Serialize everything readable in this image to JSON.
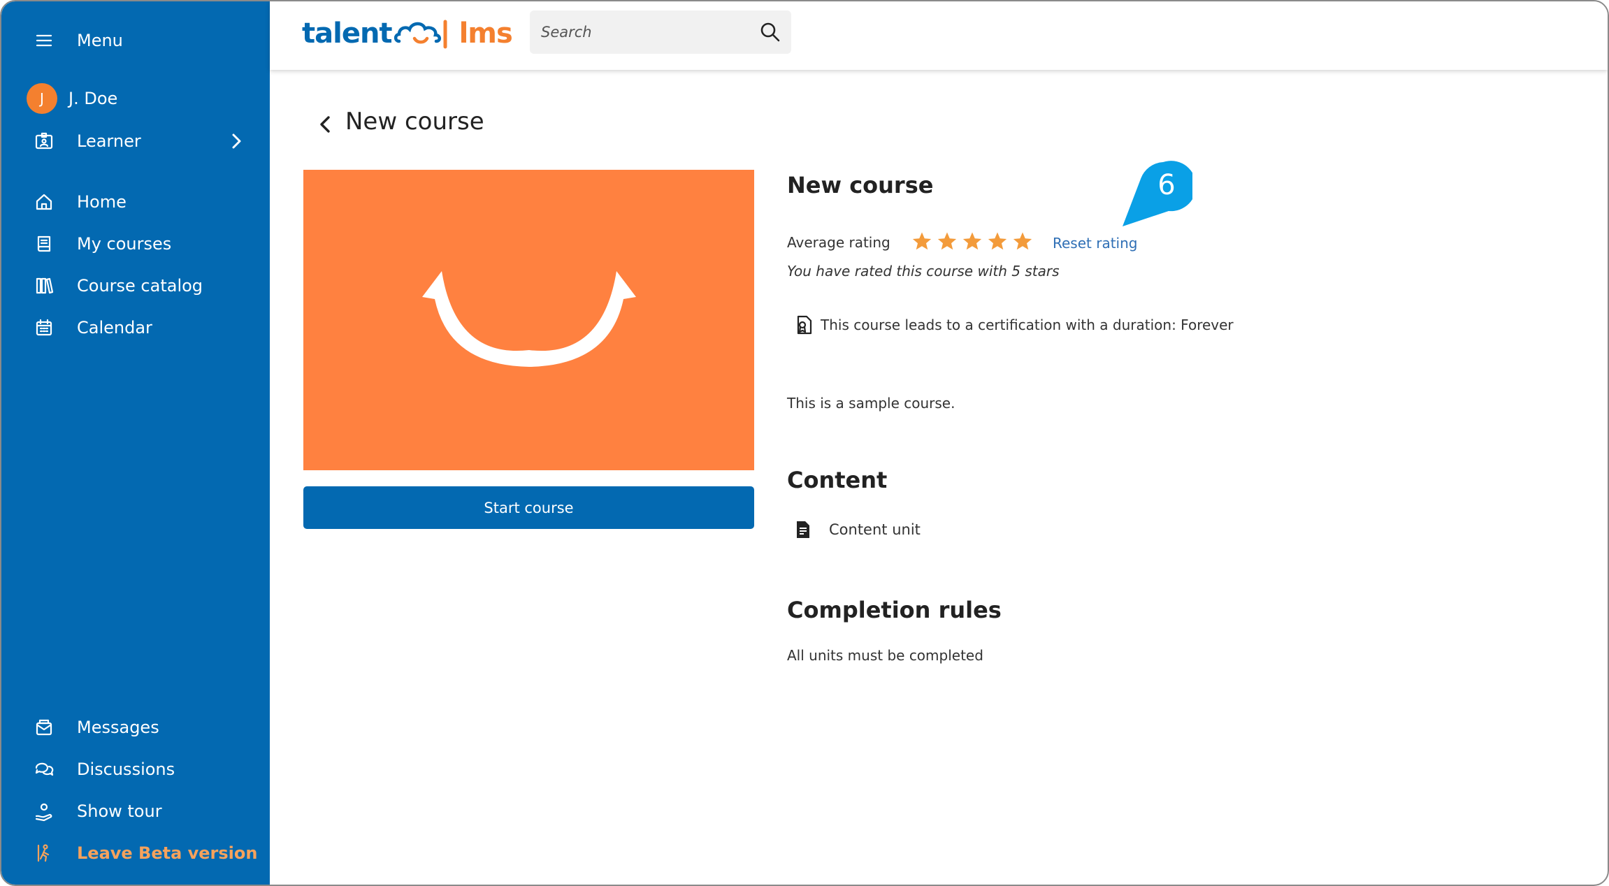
{
  "sidebar": {
    "menu_label": "Menu",
    "user": {
      "initial": "J",
      "name": "J. Doe"
    },
    "role": "Learner",
    "nav": [
      {
        "label": "Home",
        "icon": "home-icon"
      },
      {
        "label": "My courses",
        "icon": "book-icon"
      },
      {
        "label": "Course catalog",
        "icon": "library-icon"
      },
      {
        "label": "Calendar",
        "icon": "calendar-icon"
      }
    ],
    "bottom": [
      {
        "label": "Messages",
        "icon": "messages-icon"
      },
      {
        "label": "Discussions",
        "icon": "discussions-icon"
      },
      {
        "label": "Show tour",
        "icon": "tour-icon"
      },
      {
        "label": "Leave Beta version",
        "icon": "leave-icon"
      }
    ]
  },
  "header": {
    "logo_left": "talent",
    "logo_right": "lms",
    "search_placeholder": "Search"
  },
  "main": {
    "page_title": "New course",
    "course_title": "New course",
    "rating_label": "Average rating",
    "rating_value": 5,
    "rating_max": 5,
    "reset_label": "Reset rating",
    "rated_text": "You have rated this course with 5 stars",
    "certification_text": "This course leads to a certification with a duration: Forever",
    "description": "This is a sample course.",
    "content_heading": "Content",
    "content_unit": "Content unit",
    "completion_heading": "Completion rules",
    "completion_text": "All units must be completed",
    "start_button": "Start course"
  },
  "callout": {
    "number": "6"
  },
  "colors": {
    "sidebar": "#0369b1",
    "accent_orange": "#f4802f",
    "cover": "#ff8140",
    "star": "#f39b3b",
    "link": "#2f6fb5",
    "callout": "#0aa0e6"
  }
}
